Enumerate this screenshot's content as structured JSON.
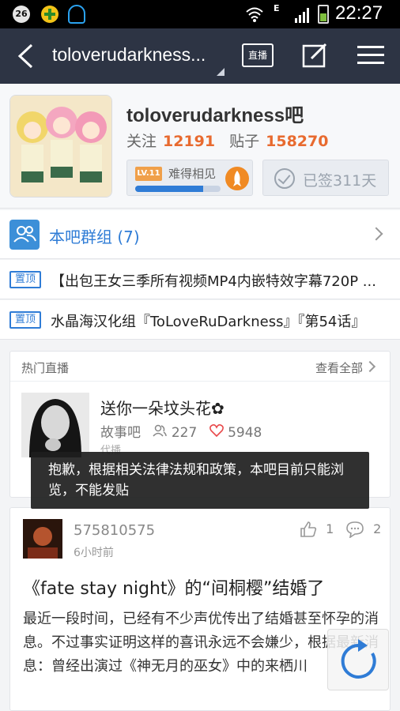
{
  "statusbar": {
    "badge_number": "26",
    "network": "E",
    "time": "22:27"
  },
  "navbar": {
    "title": "toloverudarkness...",
    "live_label": "直播",
    "back_icon": "back-arrow-icon",
    "edit_icon": "edit-icon",
    "menu_icon": "menu-icon"
  },
  "forum": {
    "name": "toloverudarkness吧",
    "follow_label": "关注",
    "follow_count": "12191",
    "posts_label": "贴子",
    "posts_count": "158270",
    "level_badge": "LV.11",
    "level_title": "难得相见",
    "level_progress": 0.8,
    "signed_label": "已签311天"
  },
  "group": {
    "label": "本吧群组 (7)"
  },
  "pinned": [
    {
      "badge": "置顶",
      "text": "【出包王女三季所有视频MP4内嵌特效字幕720P ..."
    },
    {
      "badge": "置顶",
      "text": "水晶海汉化组『ToLoveRuDarkness』『第54话』"
    }
  ],
  "live": {
    "section_title": "热门直播",
    "view_all": "查看全部",
    "item": {
      "title": "送你一朵坟头花✿",
      "forum": "故事吧",
      "viewers": "227",
      "likes": "5948",
      "sub": "代播"
    }
  },
  "toast": {
    "text": "抱歉，根据相关法律法规和政策，本吧目前只能浏览，不能发贴"
  },
  "post": {
    "user": "575810575",
    "time": "6小时前",
    "likes": "1",
    "comments": "2",
    "title": "《fate stay night》的“间桐樱”结婚了",
    "body": "最近一段时间，已经有不少声优传出了结婚甚至怀孕的消息。不过事实证明这样的喜讯永远不会嫌少，根据最新消息：曾经出演过《神无月的巫女》中的来栖川"
  },
  "colors": {
    "nav_bg": "#2d3444",
    "accent_blue": "#2f7cd6",
    "accent_orange": "#e86a2f"
  }
}
